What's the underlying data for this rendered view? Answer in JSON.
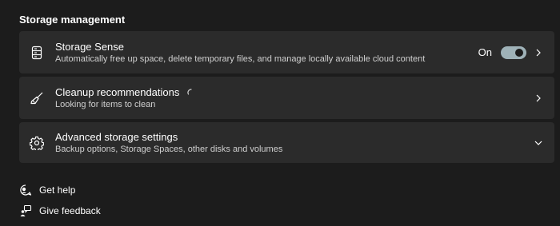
{
  "section": {
    "title": "Storage management"
  },
  "storage_sense": {
    "title": "Storage Sense",
    "description": "Automatically free up space, delete temporary files, and manage locally available cloud content",
    "toggle_state": "On",
    "icon": "storage-drive-icon"
  },
  "cleanup": {
    "title": "Cleanup recommendations",
    "description": "Looking for items to clean",
    "icon": "broom-icon"
  },
  "advanced": {
    "title": "Advanced storage settings",
    "description": "Backup options, Storage Spaces, other disks and volumes",
    "icon": "gear-icon"
  },
  "links": {
    "help": "Get help",
    "feedback": "Give feedback"
  },
  "colors": {
    "background": "#1c1c1c",
    "card": "#2b2b2b",
    "toggle_on": "#9fb2b8"
  }
}
